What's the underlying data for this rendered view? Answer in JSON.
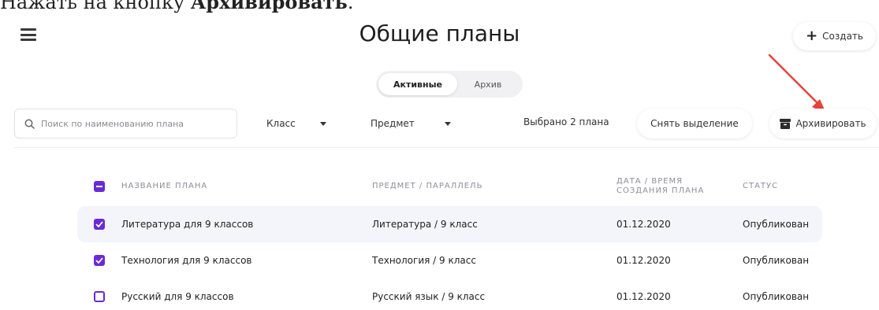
{
  "instruction": {
    "prefix": "Нажать на кнопку ",
    "bold": "Архивировать",
    "suffix": "."
  },
  "header": {
    "title": "Общие планы",
    "create_label": "Создать"
  },
  "tabs": [
    {
      "label": "Активные",
      "active": true
    },
    {
      "label": "Архив",
      "active": false
    }
  ],
  "toolbar": {
    "search_placeholder": "Поиск по наименованию плана",
    "class_filter": "Класс",
    "subject_filter": "Предмет",
    "selected_count": "Выбрано 2 плана",
    "deselect_label": "Снять выделение",
    "archive_label": "Архивировать"
  },
  "table": {
    "headers": {
      "name": "Название плана",
      "subject": "Предмет / Параллель",
      "date_line1": "Дата / Время",
      "date_line2": "создания плана",
      "status": "Статус"
    },
    "rows": [
      {
        "checked": true,
        "name": "Литература для 9 классов",
        "subject": "Литература / 9 класс",
        "date": "01.12.2020",
        "status": "Опубликован"
      },
      {
        "checked": true,
        "name": "Технология для 9 классов",
        "subject": "Технология / 9 класс",
        "date": "01.12.2020",
        "status": "Опубликован"
      },
      {
        "checked": false,
        "name": "Русский для 9 классов",
        "subject": "Русский язык / 9 класс",
        "date": "01.12.2020",
        "status": "Опубликован"
      }
    ]
  },
  "colors": {
    "accent": "#6a2ad6",
    "arrow": "#e8423a"
  },
  "icons": {
    "menu": "hamburger-icon",
    "search": "search-icon",
    "archive": "archive-box-icon"
  }
}
